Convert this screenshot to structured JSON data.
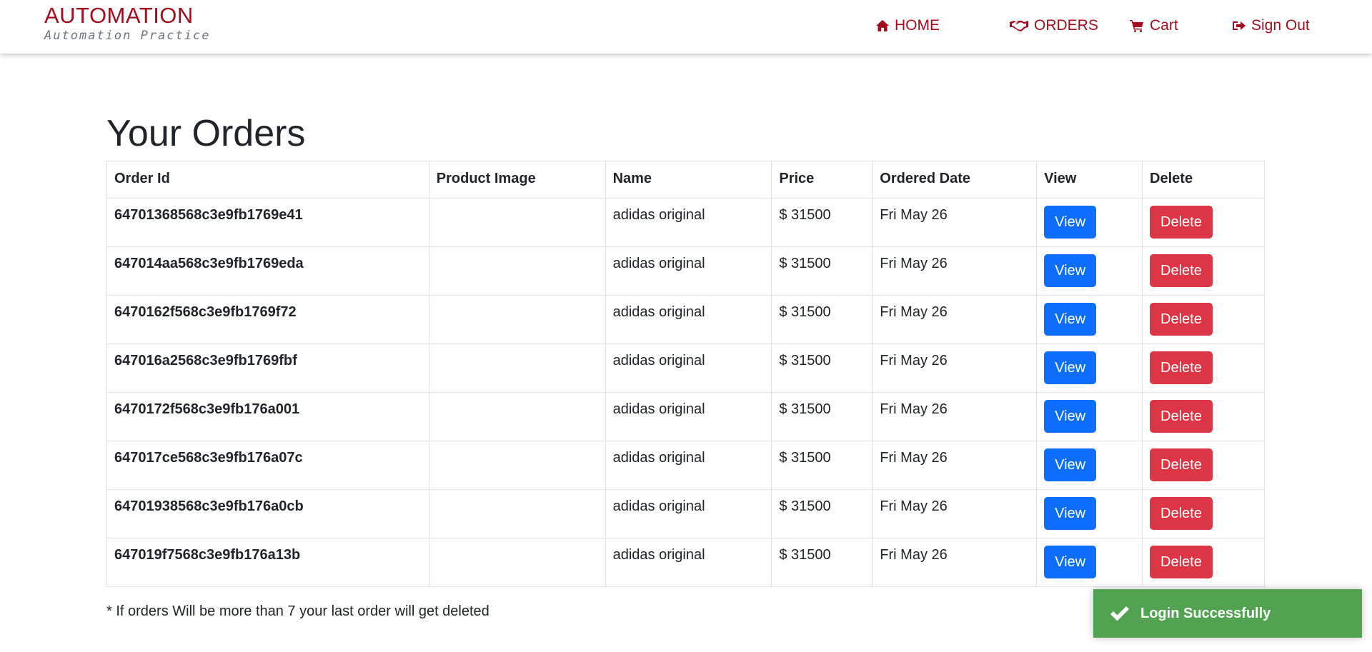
{
  "brand": {
    "title": "AUTOMATION",
    "subtitle": "Automation Practice"
  },
  "nav": {
    "home": "HOME",
    "orders": "ORDERS",
    "cart": "Cart",
    "signout": "Sign Out"
  },
  "page": {
    "title": "Your Orders"
  },
  "table": {
    "headers": [
      "Order Id",
      "Product Image",
      "Name",
      "Price",
      "Ordered Date",
      "View",
      "Delete"
    ],
    "view_label": "View",
    "delete_label": "Delete",
    "rows": [
      {
        "order_id": "64701368568c3e9fb1769e41",
        "name": "adidas original",
        "price": "$ 31500",
        "date": "Fri May 26"
      },
      {
        "order_id": "647014aa568c3e9fb1769eda",
        "name": "adidas original",
        "price": "$ 31500",
        "date": "Fri May 26"
      },
      {
        "order_id": "6470162f568c3e9fb1769f72",
        "name": "adidas original",
        "price": "$ 31500",
        "date": "Fri May 26"
      },
      {
        "order_id": "647016a2568c3e9fb1769fbf",
        "name": "adidas original",
        "price": "$ 31500",
        "date": "Fri May 26"
      },
      {
        "order_id": "6470172f568c3e9fb176a001",
        "name": "adidas original",
        "price": "$ 31500",
        "date": "Fri May 26"
      },
      {
        "order_id": "647017ce568c3e9fb176a07c",
        "name": "adidas original",
        "price": "$ 31500",
        "date": "Fri May 26"
      },
      {
        "order_id": "64701938568c3e9fb176a0cb",
        "name": "adidas original",
        "price": "$ 31500",
        "date": "Fri May 26"
      },
      {
        "order_id": "647019f7568c3e9fb176a13b",
        "name": "adidas original",
        "price": "$ 31500",
        "date": "Fri May 26"
      }
    ]
  },
  "note": "* If orders Will be more than 7 your last order will get deleted",
  "toast": {
    "message": "Login Successfully"
  },
  "colors": {
    "brand": "#a10f1e",
    "view": "#0d6efd",
    "delete": "#dc3545",
    "toast": "#51a351"
  }
}
